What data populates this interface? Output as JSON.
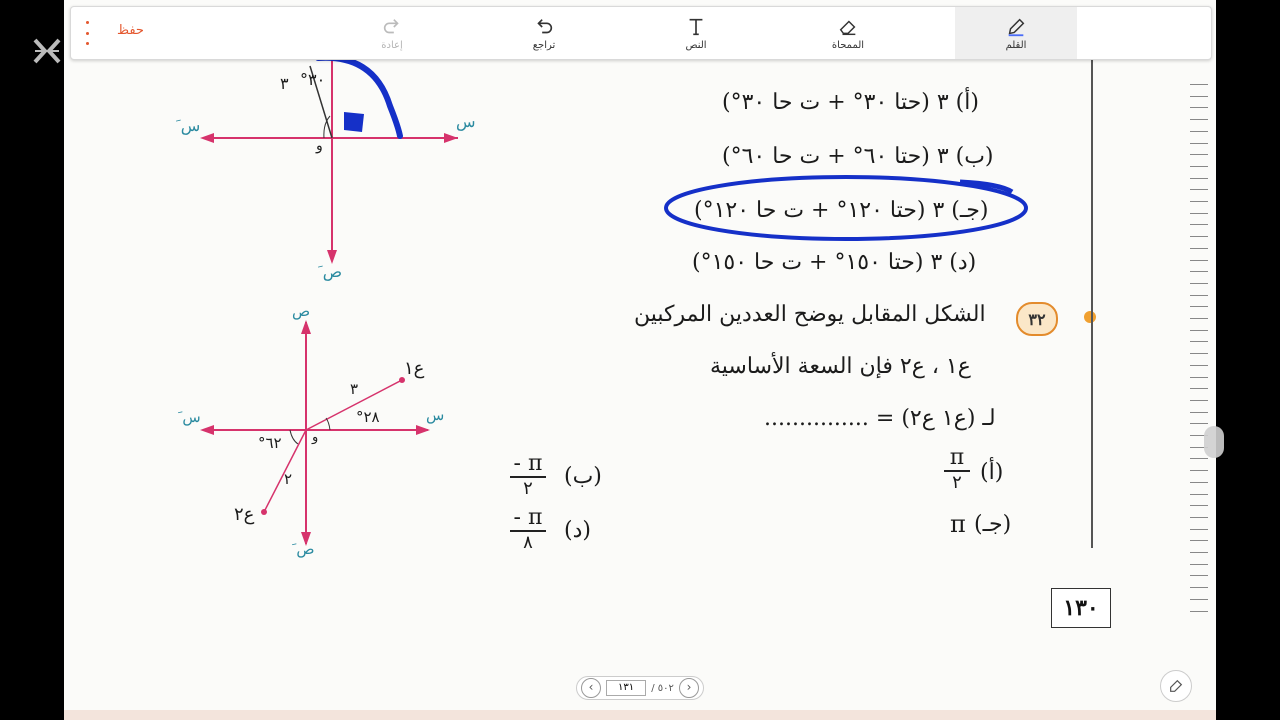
{
  "toolbar": {
    "pen_label": "القلم",
    "eraser_label": "الممحاة",
    "text_label": "النص",
    "undo_label": "تراجع",
    "redo_label": "إعادة",
    "save_label": "حفظ"
  },
  "question_top": {
    "options": [
      "(أ) ٣ (حتا ٣٠° + ت حا ٣٠°)",
      "(ب) ٣ (حتا ٦٠° + ت حا ٦٠°)",
      "(جـ) ٣ (حتا ١٢٠° + ت حا ١٢٠°)",
      "(د) ٣ (حتا ١٥٠° + ت حا ١٥٠°)"
    ],
    "diagram": {
      "x_pos": "س",
      "x_neg": "س َ",
      "y_neg": "ص َ",
      "origin": "و",
      "modulus": "٣",
      "angle": "٣٠°"
    }
  },
  "question_32": {
    "number": "٣٢",
    "line1": "الشكل المقابل يوضح العددين المركبين",
    "line2": "ع١ ، ع٢ فإن السعة الأساسية",
    "line3": "لـ (ع١ ع٢) = ...............",
    "option_a_label": "(أ)",
    "option_a_num": "π",
    "option_a_den": "٢",
    "option_b_label": "(ب)",
    "option_b_num": "- π",
    "option_b_den": "٢",
    "option_c_label": "(جـ)",
    "option_c_value": "π",
    "option_d_label": "(د)",
    "option_d_num": "- π",
    "option_d_den": "٨",
    "diagram": {
      "y_pos": "ص",
      "y_neg": "ص َ",
      "x_pos": "س",
      "x_neg": "س َ",
      "origin": "و",
      "z1": "ع١",
      "z2": "ع٢",
      "mod1": "٣",
      "mod2": "٢",
      "angle1": "٢٨°",
      "angle2": "٦٢°"
    }
  },
  "page_number": "١٣٠",
  "pager": {
    "current": "١٣١",
    "total": "/ ٥٠٢"
  },
  "colors": {
    "accent": "#e4572e",
    "ink_blue": "#1530c8",
    "axis_pink": "#d6336c"
  }
}
